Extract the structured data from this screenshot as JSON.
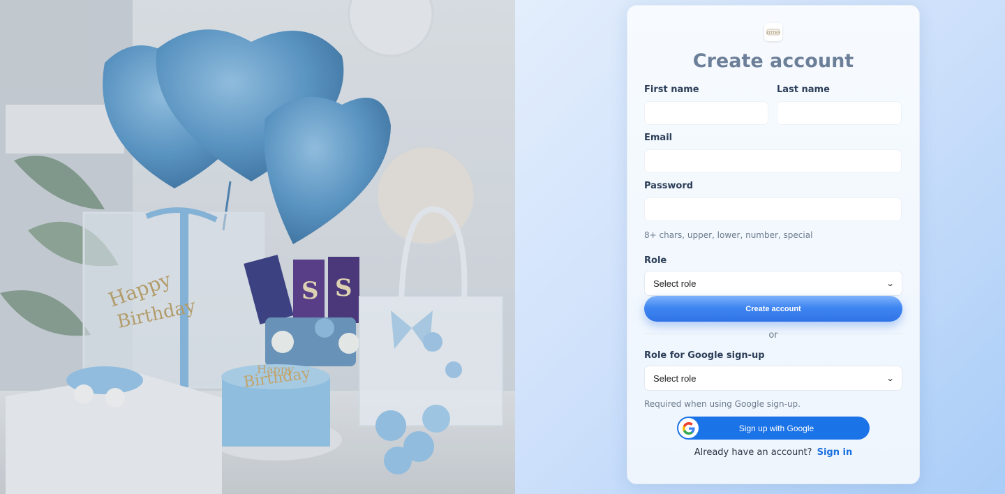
{
  "photo": {
    "alt_topic": "birthday-gift-photo"
  },
  "card": {
    "logo_icon": "brand-logo-icon",
    "title": "Create account",
    "fields": {
      "first_name_label": "First name",
      "first_name_value": "",
      "last_name_label": "Last name",
      "last_name_value": "",
      "email_label": "Email",
      "email_value": "",
      "password_label": "Password",
      "password_value": "",
      "password_hint": "8+ chars, upper, lower, number, special",
      "role_label": "Role",
      "role_selected": "Select role"
    },
    "create_button": "Create account",
    "or_text": "or",
    "google_role_label": "Role for Google sign-up",
    "google_role_selected": "Select role",
    "google_role_hint": "Required when using Google sign-up.",
    "google_button": "Sign up with Google",
    "google_icon": "google-icon",
    "signin_prompt": "Already have an account?",
    "signin_link": "Sign in"
  },
  "colors": {
    "accent": "#1b73e8",
    "button_gradient_top": "#7fb2fb",
    "button_gradient_bottom": "#2f73e6",
    "title": "#6c7f98",
    "background": "#cfe1fb"
  }
}
